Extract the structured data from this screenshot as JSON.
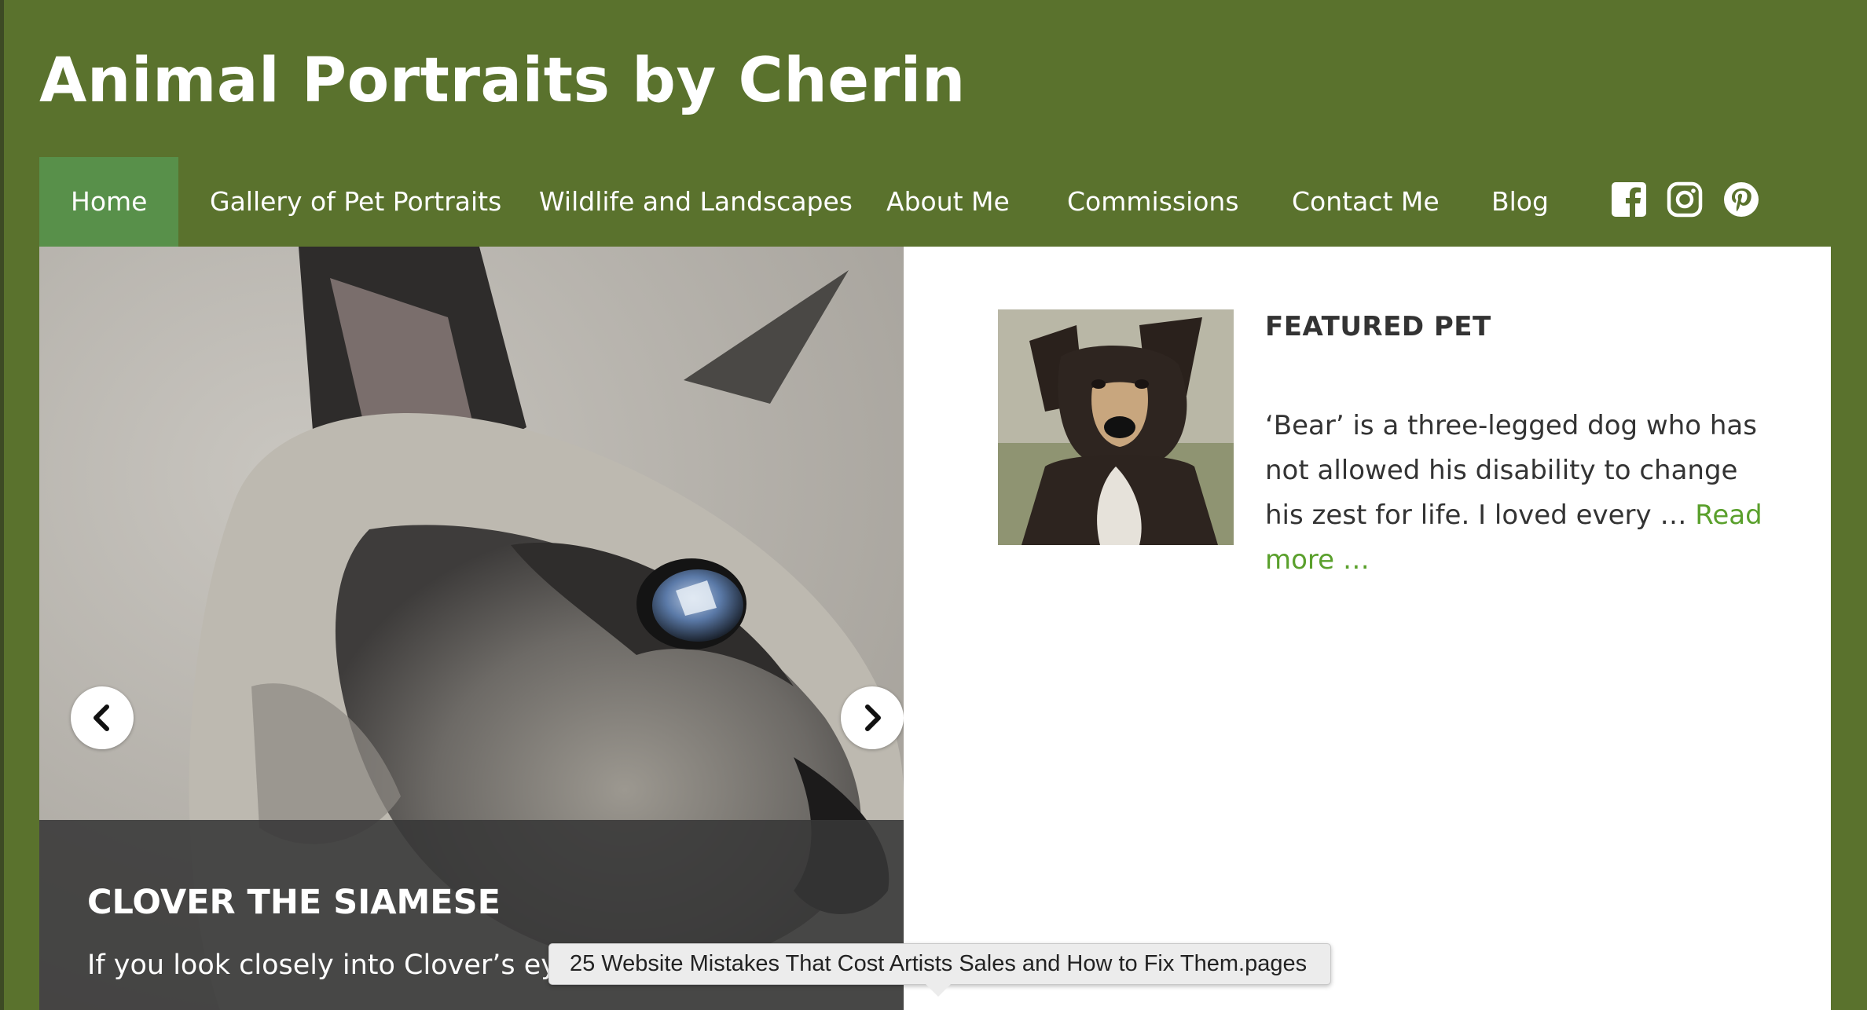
{
  "site": {
    "title": "Animal Portraits by Cherin"
  },
  "nav": {
    "items": [
      {
        "label": "Home",
        "active": true
      },
      {
        "label": "Gallery of Pet Portraits"
      },
      {
        "label": "Wildlife and Landscapes"
      },
      {
        "label": "About Me"
      },
      {
        "label": "Commissions"
      },
      {
        "label": "Contact Me"
      },
      {
        "label": "Blog"
      }
    ],
    "social": [
      "facebook-icon",
      "instagram-icon",
      "pinterest-icon"
    ]
  },
  "slider": {
    "caption_title": "CLOVER THE SIAMESE",
    "caption_text": "If you look closely into Clover’s eye.",
    "prev_icon": "chevron-left-icon",
    "next_icon": "chevron-right-icon"
  },
  "featured": {
    "heading": "FEATURED PET",
    "text": "‘Bear’ is a three-legged dog who has not allowed his disability to change his zest for life. I loved every … ",
    "read_more": "Read more …"
  },
  "tooltip": {
    "text": "25 Website Mistakes That Cost Artists Sales  and How to Fix Them.pages"
  },
  "colors": {
    "header_bg": "#5a722d",
    "nav_active_bg": "#58904a",
    "link": "#5aa02c",
    "text": "#333333"
  }
}
